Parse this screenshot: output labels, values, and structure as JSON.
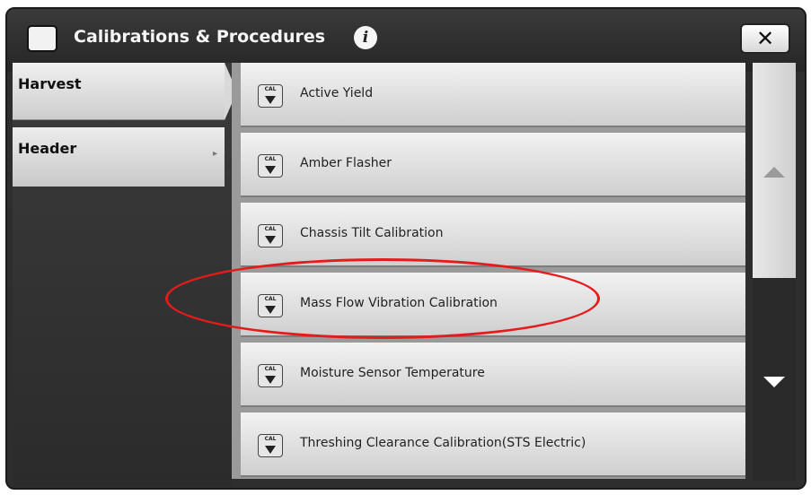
{
  "titlebar": {
    "title": "Calibrations & Procedures",
    "title_icon": "calibration-icon",
    "info_icon": "i",
    "close_label": "✕"
  },
  "sidebar": {
    "tabs": [
      {
        "label": "Harvest",
        "selected": true
      },
      {
        "label": "Header",
        "selected": false,
        "arrow": "▸"
      }
    ]
  },
  "list": {
    "icon_text": "CAL",
    "items": [
      {
        "label": "Active Yield"
      },
      {
        "label": "Amber Flasher"
      },
      {
        "label": "Chassis Tilt Calibration"
      },
      {
        "label": "Mass Flow Vibration Calibration",
        "highlighted": true
      },
      {
        "label": "Moisture Sensor Temperature"
      },
      {
        "label": "Threshing Clearance Calibration(STS Electric)"
      }
    ]
  },
  "annotation": {
    "color": "#e51b1b"
  }
}
